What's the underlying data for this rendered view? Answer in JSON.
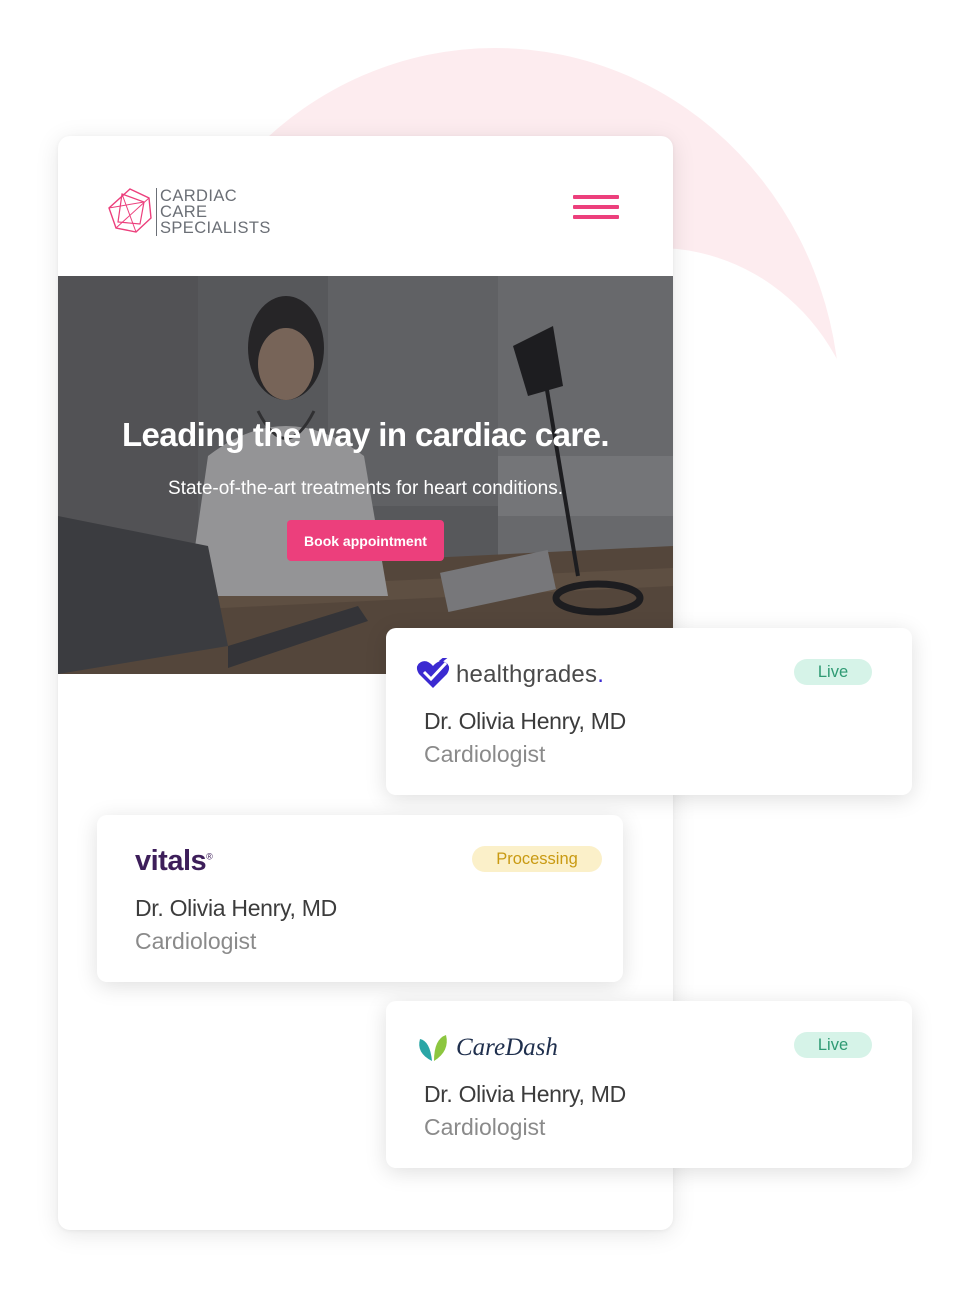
{
  "site": {
    "logo_lines": [
      "CARDIAC",
      "CARE",
      "SPECIALISTS"
    ],
    "hero": {
      "title": "Leading the way in cardiac care.",
      "subtitle": "State-of-the-art treatments for heart conditions.",
      "cta_label": "Book appointment"
    }
  },
  "colors": {
    "accent": "#ec3f7c",
    "ring": "#fdecef",
    "live": "#2f9a73",
    "processing": "#c99a12",
    "vitals": "#3d1e5a",
    "healthgrades": "#3b2ad1",
    "caredash_green": "#8cc63f",
    "caredash_teal": "#2aa6a6"
  },
  "listings": [
    {
      "brand": "healthgrades",
      "brand_suffix": ".",
      "status": "Live",
      "doctor": "Dr. Olivia Henry, MD",
      "specialty": "Cardiologist",
      "brand_icon": "healthgrades-heart-icon"
    },
    {
      "brand": "vitals",
      "brand_suffix": "®",
      "status": "Processing",
      "doctor": "Dr. Olivia Henry, MD",
      "specialty": "Cardiologist",
      "brand_icon": ""
    },
    {
      "brand": "CareDash",
      "brand_suffix": "",
      "status": "Live",
      "doctor": "Dr. Olivia Henry, MD",
      "specialty": "Cardiologist",
      "brand_icon": "caredash-leaf-icon"
    }
  ]
}
